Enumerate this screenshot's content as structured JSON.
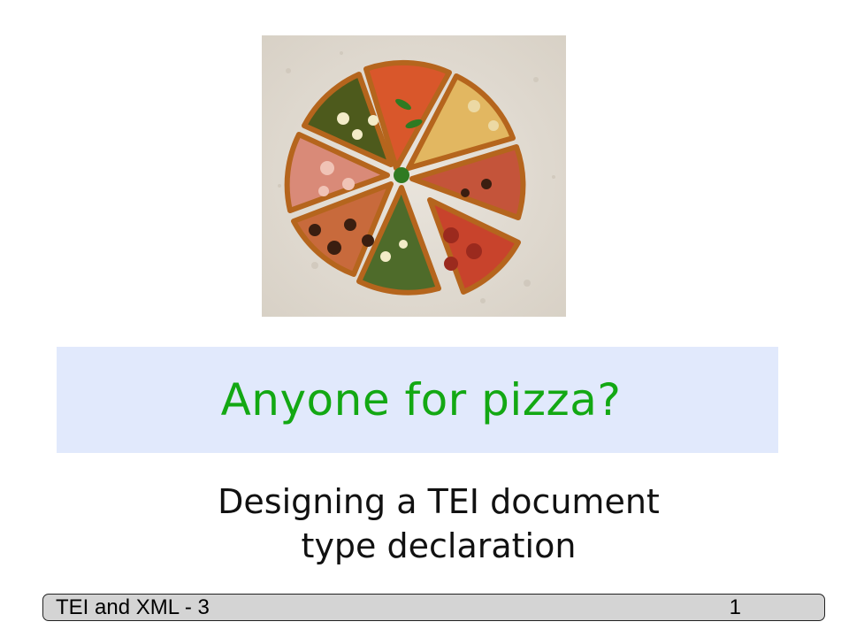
{
  "slide": {
    "title": "Anyone for pizza?",
    "subtitle_line1": "Designing a TEI document",
    "subtitle_line2": "type declaration"
  },
  "footer": {
    "course": "TEI and XML - 3",
    "page_number": "1"
  },
  "image": {
    "subject": "pizza-photo"
  },
  "colors": {
    "title_text": "#13a813",
    "title_band": "#e1e9fc",
    "footer_bg": "#d4d4d4"
  }
}
